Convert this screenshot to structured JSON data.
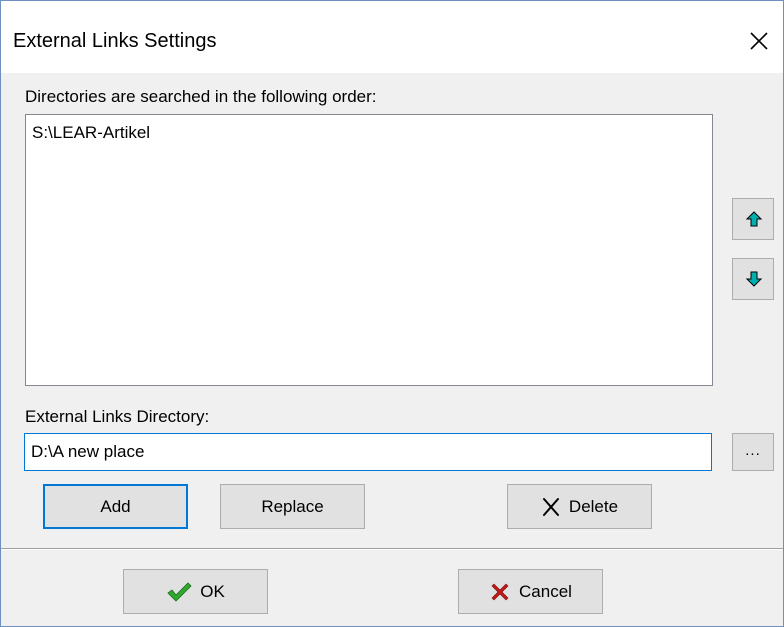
{
  "window": {
    "title": "External Links Settings"
  },
  "order_section": {
    "label": "Directories are searched in the following order:",
    "directories": [
      "S:\\LEAR-Artikel"
    ]
  },
  "directory_section": {
    "label": "External Links Directory:",
    "value": "D:\\A new place",
    "browse_label": "..."
  },
  "buttons": {
    "add": "Add",
    "replace": "Replace",
    "delete": "Delete",
    "ok": "OK",
    "cancel": "Cancel"
  },
  "icons": {
    "move_up": "arrow-up-icon",
    "move_down": "arrow-down-icon",
    "delete": "x-mark-icon",
    "ok": "checkmark-icon",
    "cancel": "red-x-icon",
    "close": "close-icon"
  },
  "colors": {
    "arrow_fill": "#00b0b0",
    "ok_check": "#2ea82e",
    "cancel_x": "#c01a1a",
    "focus_blue": "#0078d7"
  }
}
